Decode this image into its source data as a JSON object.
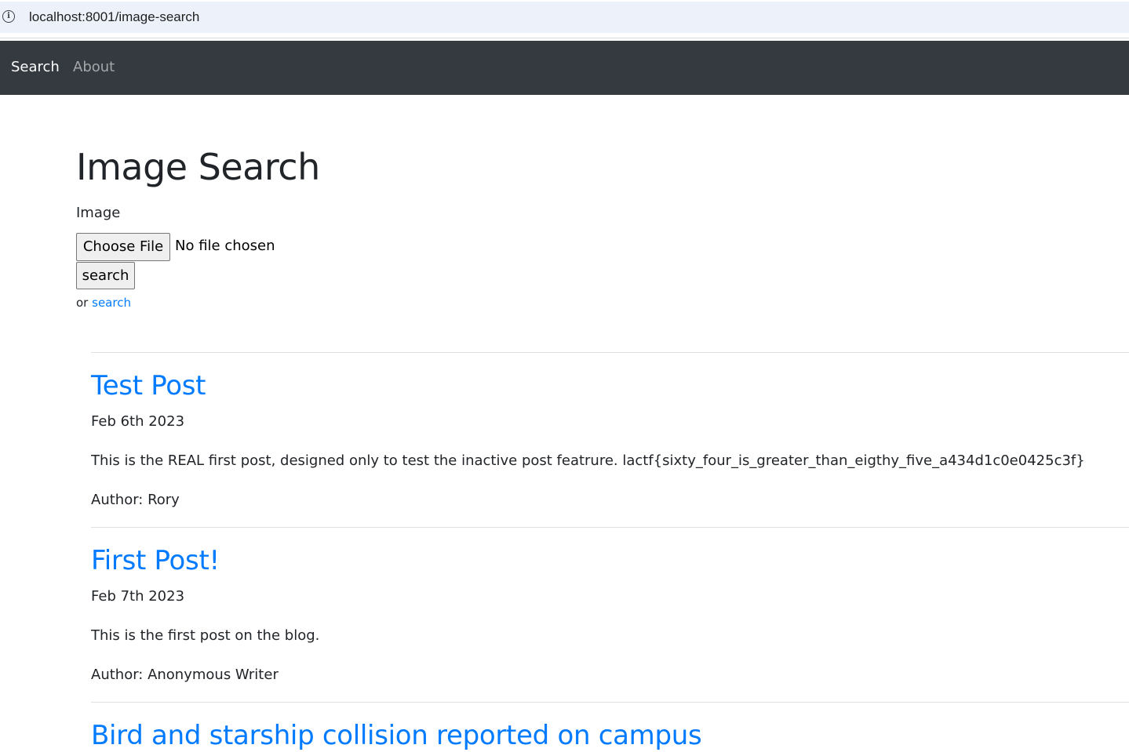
{
  "browser": {
    "url": "localhost:8001/image-search"
  },
  "navbar": {
    "items": [
      {
        "label": "Search"
      },
      {
        "label": "About"
      }
    ]
  },
  "main": {
    "title": "Image Search",
    "image_label": "Image",
    "choose_file_label": "Choose File",
    "no_file_text": "No file chosen",
    "search_button_label": "search",
    "or_text": "or",
    "search_link_label": "search"
  },
  "posts": [
    {
      "title": "Test Post",
      "date": "Feb 6th 2023",
      "body": "This is the REAL first post, designed only to test the inactive post featrure. lactf{sixty_four_is_greater_than_eigthy_five_a434d1c0e0425c3f}",
      "author": "Author: Rory"
    },
    {
      "title": "First Post!",
      "date": "Feb 7th 2023",
      "body": "This is the first post on the blog.",
      "author": "Author: Anonymous Writer"
    },
    {
      "title": "Bird and starship collision reported on campus"
    }
  ],
  "colors": {
    "navbar_bg": "#343a40",
    "link": "#007bff",
    "text": "#212529"
  }
}
